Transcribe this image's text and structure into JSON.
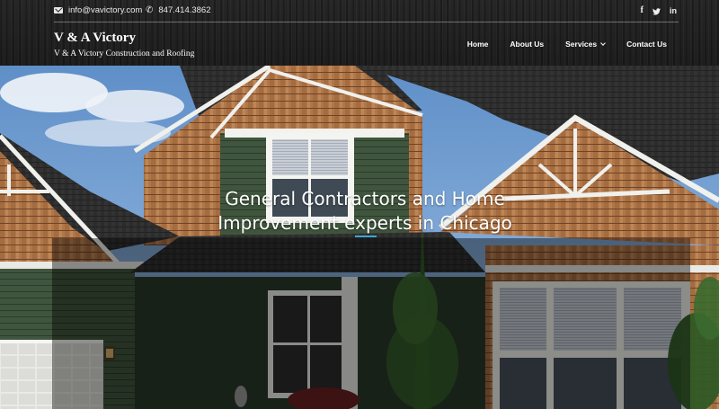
{
  "topbar": {
    "email": "info@vavictory.com",
    "phone": "847.414.3862",
    "email_icon": "envelope-icon",
    "phone_icon": "phone-icon",
    "social": [
      {
        "name": "facebook-icon",
        "glyph": "f"
      },
      {
        "name": "twitter-icon",
        "glyph": ""
      },
      {
        "name": "linkedin-icon",
        "glyph": "in"
      }
    ]
  },
  "brand": {
    "title": "V & A Victory",
    "subtitle": "V & A Victory Construction and Roofing"
  },
  "nav": {
    "items": [
      {
        "label": "Home"
      },
      {
        "label": "About Us"
      },
      {
        "label": "Services"
      },
      {
        "label": "Contact Us"
      }
    ]
  },
  "hero": {
    "headline_line1": "General Contractors and Home",
    "headline_line2": "Improvement experts in Chicago",
    "accent_color": "#3aa8d8"
  }
}
